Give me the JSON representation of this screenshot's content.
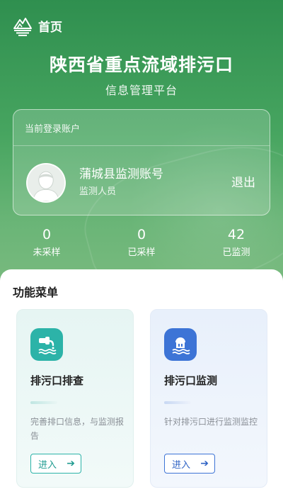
{
  "nav": {
    "title": "首页",
    "logo_icon": "mountain-logo-icon"
  },
  "header": {
    "title": "陕西省重点流域排污口",
    "subtitle": "信息管理平台"
  },
  "account": {
    "label": "当前登录账户",
    "name": "蒲城县监测账号",
    "role": "监测人员",
    "logout_label": "退出",
    "avatar_icon": "user-avatar-icon"
  },
  "stats": [
    {
      "value": "0",
      "label": "未采样"
    },
    {
      "value": "0",
      "label": "已采样"
    },
    {
      "value": "42",
      "label": "已监测"
    }
  ],
  "menu": {
    "title": "功能菜单",
    "items": [
      {
        "name": "排污口排查",
        "desc": "完善排口信息，与监测报告",
        "button": "进入",
        "icon": "sewage-outlet-icon",
        "accent": "#2cb3a8"
      },
      {
        "name": "排污口监测",
        "desc": "针对排污口进行监测监控",
        "button": "进入",
        "icon": "monitoring-station-icon",
        "accent": "#3d74d6"
      }
    ]
  },
  "colors": {
    "brand_green": "#3a9a57",
    "teal": "#2cb3a8",
    "blue": "#3d74d6"
  }
}
